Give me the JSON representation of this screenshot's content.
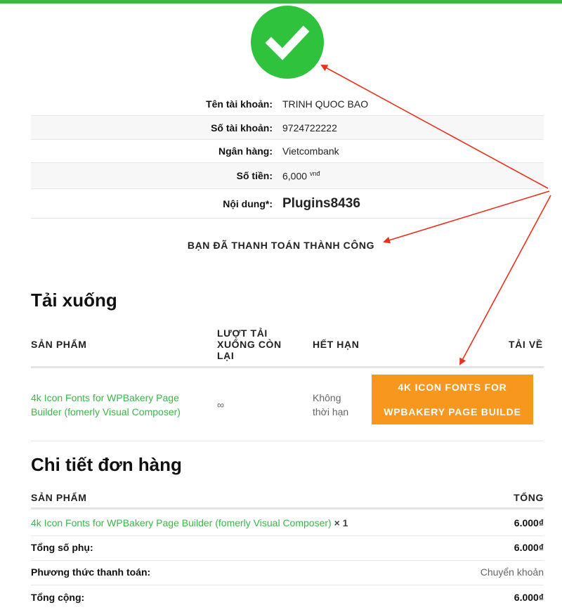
{
  "bank_info": {
    "account_name_label": "Tên tài khoản:",
    "account_name": "TRINH QUOC BAO",
    "account_number_label": "Số tài khoản:",
    "account_number": "9724722222",
    "bank_label": "Ngân hàng:",
    "bank": "Vietcombank",
    "amount_label": "Số tiền:",
    "amount": "6,000",
    "amount_unit": "vnđ",
    "content_label": "Nội dung*:",
    "content": "Plugins8436"
  },
  "success_message": "BẠN ĐÃ THANH TOÁN THÀNH CÔNG",
  "downloads": {
    "title": "Tải xuống",
    "headers": {
      "product": "SẢN PHẨM",
      "remaining_1": "LƯỢT TẢI",
      "remaining_2": "XUỐNG CÒN",
      "remaining_3": "LẠI",
      "expires": "HẾT HẠN",
      "download": "TẢI VỀ"
    },
    "row": {
      "product_1": "4k Icon Fonts for WPBakery Page",
      "product_2": "Builder (fomerly Visual Composer)",
      "remaining": "∞",
      "expires_1": "Không",
      "expires_2": "thời hạn",
      "button_1": "4K ICON FONTS FOR",
      "button_2": "WPBAKERY PAGE BUILDE"
    }
  },
  "order": {
    "title": "Chi tiết đơn hàng",
    "headers": {
      "product": "SẢN PHẨM",
      "total": "TỔNG"
    },
    "item": {
      "name": "4k Icon Fonts for WPBakery Page Builder (fomerly Visual Composer)",
      "qty": "× 1",
      "price": "6.000₫"
    },
    "subtotal_label": "Tổng số phụ:",
    "subtotal": "6.000₫",
    "payment_label": "Phương thức thanh toán:",
    "payment": "Chuyển khoản",
    "total_label": "Tổng cộng:",
    "total": "6.000₫"
  },
  "colors": {
    "accent_green": "#3cb54a",
    "button_orange": "#f7971e",
    "arrow_red": "#e8321e"
  },
  "icons": {
    "success": "check-icon"
  }
}
